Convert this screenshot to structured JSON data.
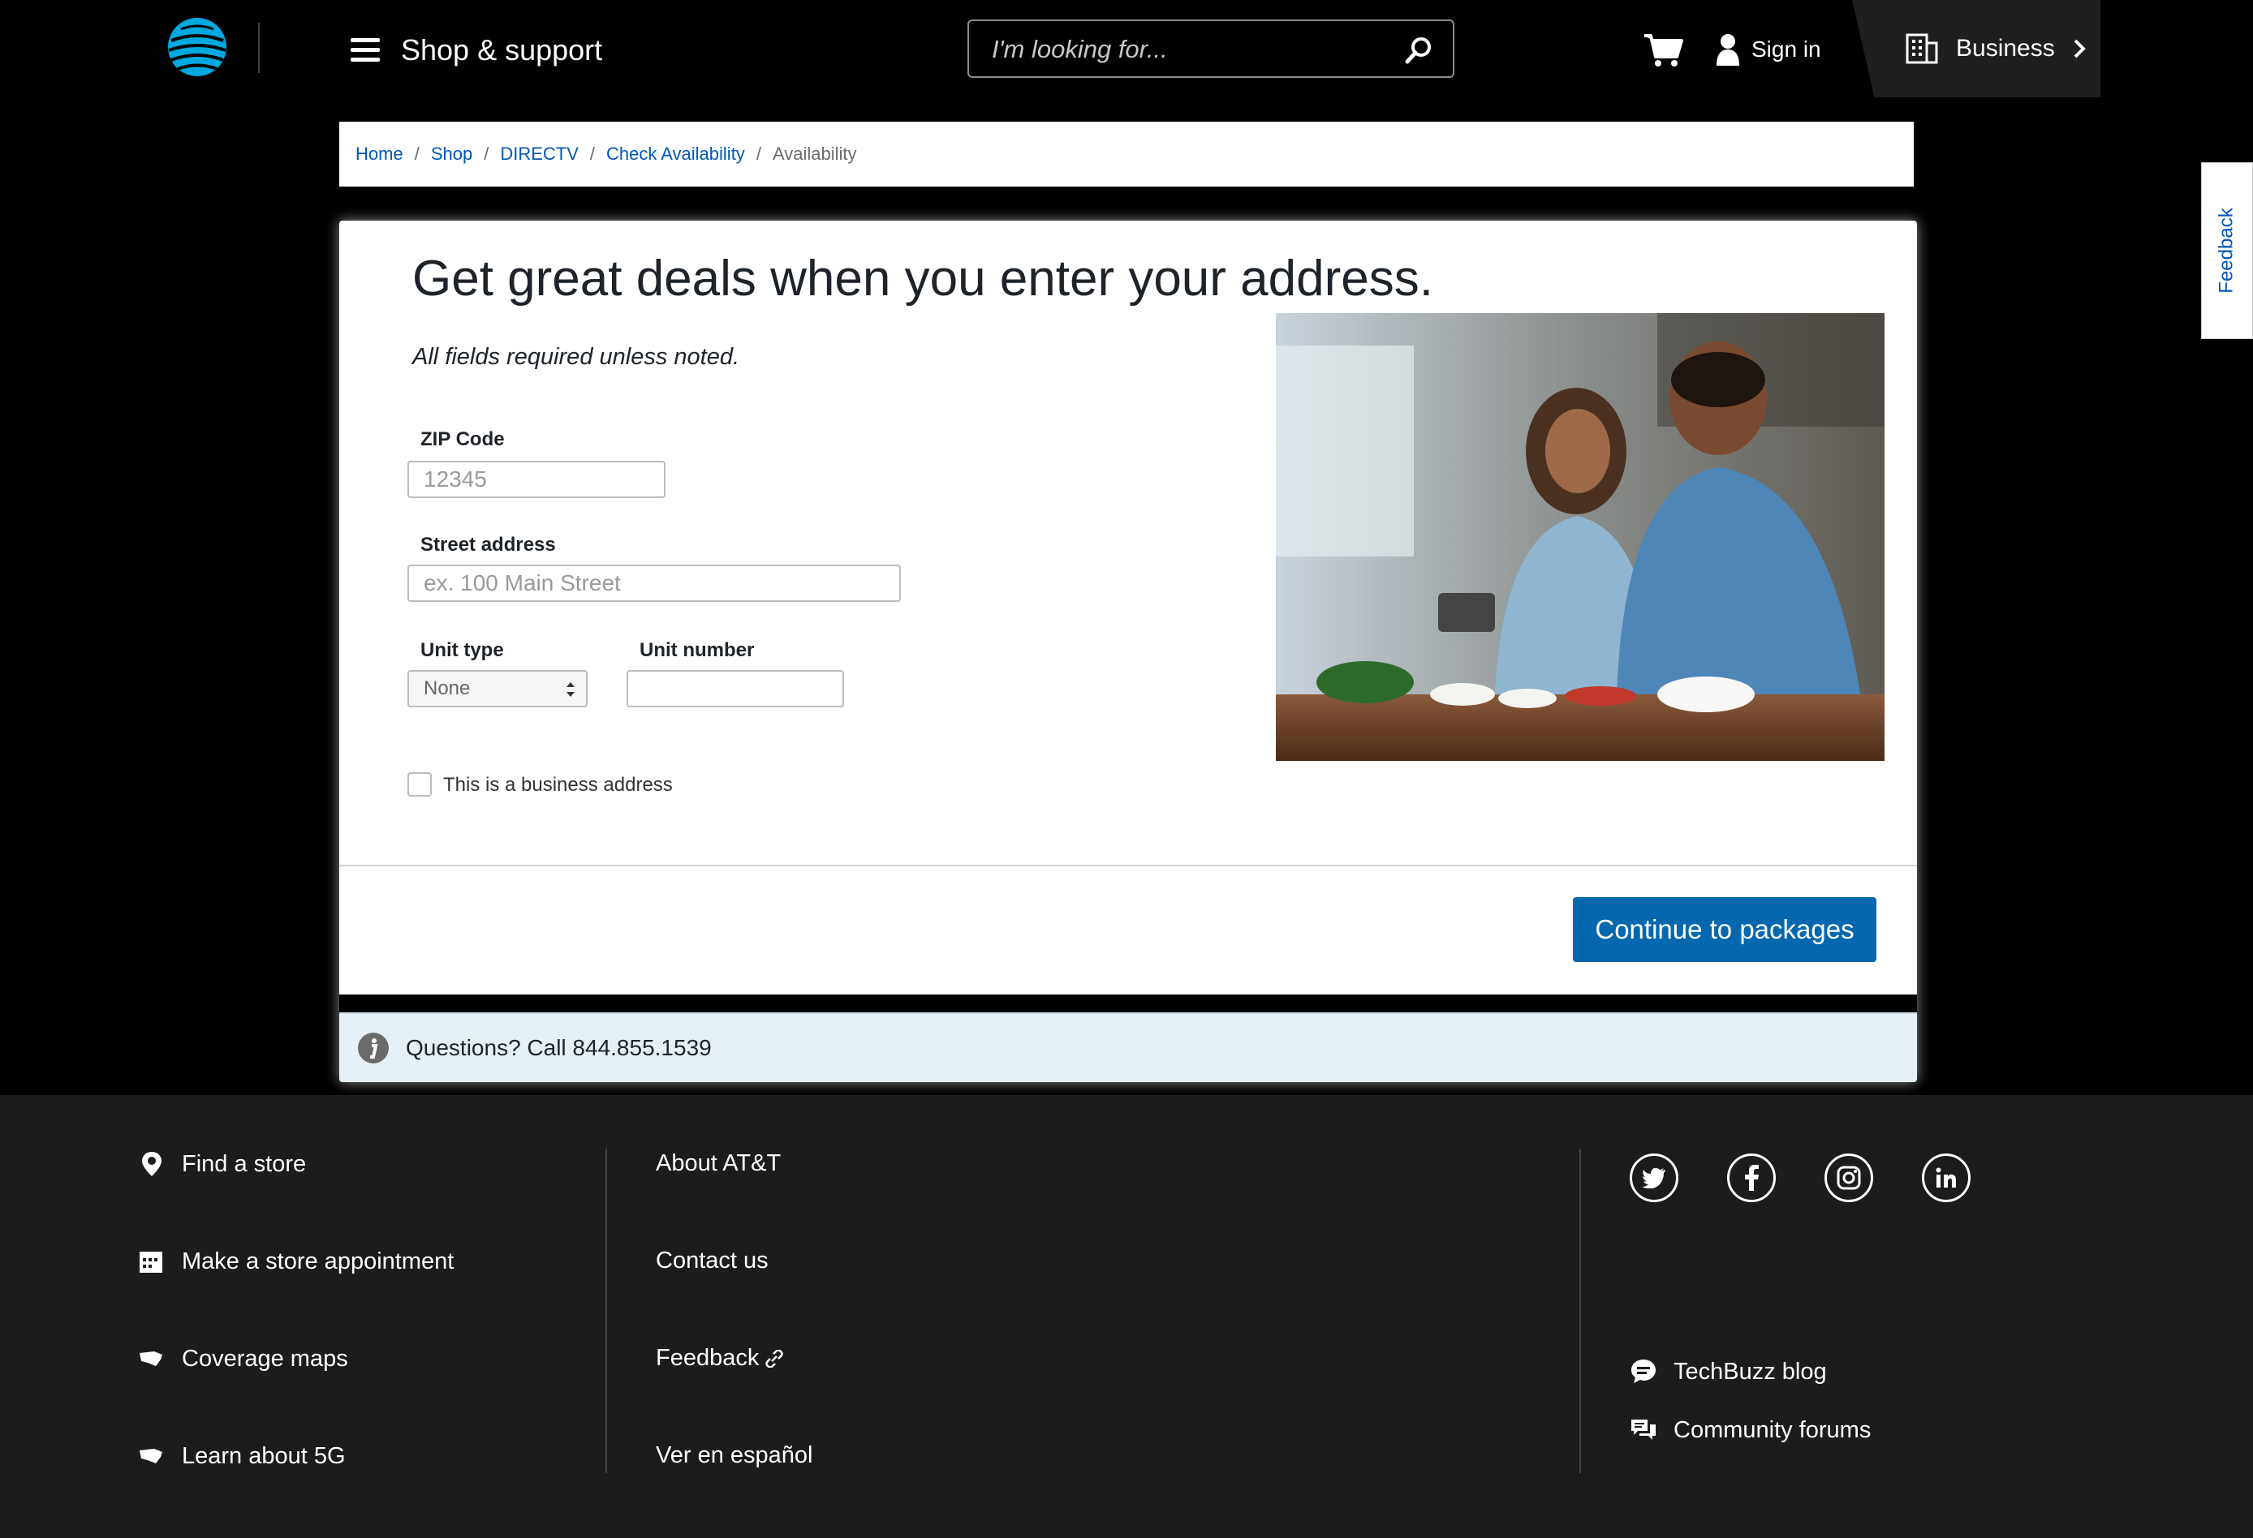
{
  "header": {
    "menu_label": "Shop & support",
    "search_placeholder": "I'm looking for...",
    "signin_label": "Sign in",
    "business_label": "Business"
  },
  "breadcrumb": {
    "items": [
      "Home",
      "Shop",
      "DIRECTV",
      "Check Availability"
    ],
    "current": "Availability"
  },
  "form": {
    "headline": "Get great deals when you enter your address.",
    "required_note": "All fields required unless noted.",
    "zip_label": "ZIP Code",
    "zip_placeholder": "12345",
    "street_label": "Street address",
    "street_placeholder": "ex. 100 Main Street",
    "unit_type_label": "Unit type",
    "unit_type_value": "None",
    "unit_number_label": "Unit number",
    "business_checkbox_label": "This is a business address",
    "cta_label": "Continue to packages",
    "questions_text": "Questions? Call 844.855.1539"
  },
  "feedback_tab": "Feedback",
  "footer": {
    "col1": [
      "Find a store",
      "Make a store appointment",
      "Coverage maps",
      "Learn about 5G"
    ],
    "col2": [
      "About AT&T",
      "Contact us",
      "Feedback",
      "Ver en español"
    ],
    "col3": [
      "TechBuzz blog",
      "Community forums"
    ]
  },
  "colors": {
    "brand_blue": "#0568ae",
    "link_blue": "#0057b8",
    "info_bg": "#e6f0f7"
  }
}
